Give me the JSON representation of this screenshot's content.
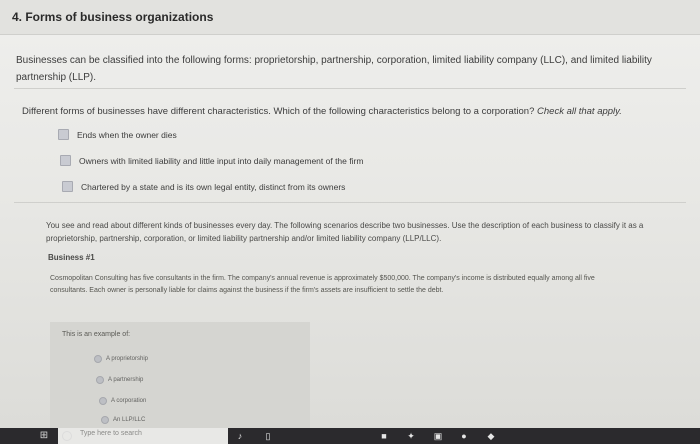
{
  "section_title": "4. Forms of business organizations",
  "intro": "Businesses can be classified into the following forms: proprietorship, partnership, corporation, limited liability company (LLC), and limited liability partnership (LLP).",
  "question": {
    "text": "Different forms of businesses have different characteristics. Which of the following characteristics belong to a corporation?",
    "instruction": "Check all that apply."
  },
  "options": [
    "Ends when the owner dies",
    "Owners with limited liability and little input into daily management of the firm",
    "Chartered by a state and is its own legal entity, distinct from its owners"
  ],
  "scenario_text": "You see and read about different kinds of businesses every day. The following scenarios describe two businesses. Use the description of each business to classify it as a proprietorship, partnership, corporation, or limited liability partnership and/or limited liability company (LLP/LLC).",
  "business1": {
    "title": "Business #1",
    "description": "Cosmopolitan Consulting has five consultants in the firm. The company's annual revenue is approximately $500,000. The company's income is distributed equally among all five consultants. Each owner is personally liable for claims against the business if the firm's assets are insufficient to settle the debt.",
    "example_label": "This is an example of:",
    "choices": [
      "A proprietorship",
      "A partnership",
      "A corporation",
      "An LLP/LLC"
    ]
  },
  "taskbar": {
    "search_placeholder": "Type here to search"
  }
}
